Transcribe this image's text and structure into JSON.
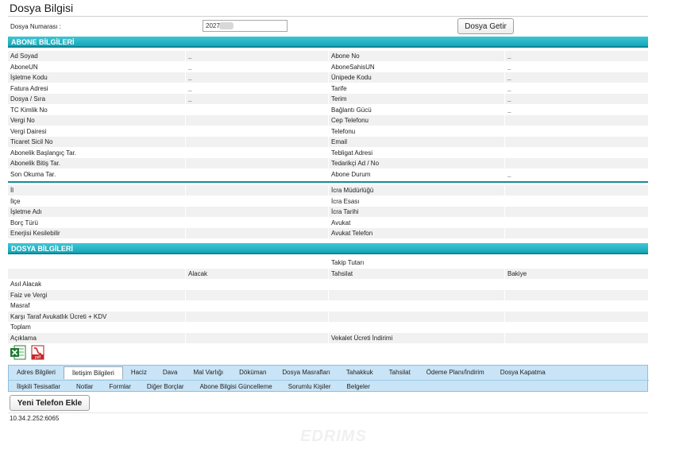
{
  "page": {
    "title": "Dosya Bilgisi"
  },
  "search": {
    "label": "Dosya Numarası :",
    "value": "2027",
    "button_label": "Dosya Getir"
  },
  "abone": {
    "section_title": "ABONE BİLGİLERİ",
    "rows": [
      {
        "label_left": "Ad Soyad",
        "value_left": "_",
        "label_right": "Abone No",
        "value_right": "_"
      },
      {
        "label_left": "AboneUN",
        "value_left": "_",
        "label_right": "AboneSahisUN",
        "value_right": "_"
      },
      {
        "label_left": "İşletme Kodu",
        "value_left": "_",
        "label_right": "Ünipede Kodu",
        "value_right": "_"
      },
      {
        "label_left": "Fatura Adresi",
        "value_left": "_",
        "label_right": "Tarife",
        "value_right": "_"
      },
      {
        "label_left": "Dosya / Sıra",
        "value_left": "_",
        "label_right": "Terim",
        "value_right": "_"
      },
      {
        "label_left": "TC Kimlik No",
        "value_left": "",
        "label_right": "Bağlantı Gücü",
        "value_right": "_"
      },
      {
        "label_left": "Vergi No",
        "value_left": "",
        "label_right": "Cep Telefonu",
        "value_right": ""
      },
      {
        "label_left": "Vergi Dairesi",
        "value_left": "",
        "label_right": "Telefonu",
        "value_right": ""
      },
      {
        "label_left": "Ticaret Sicil No",
        "value_left": "",
        "label_right": "Email",
        "value_right": ""
      },
      {
        "label_left": "Abonelik Başlangıç Tar.",
        "value_left": "",
        "label_right": "Tebligat Adresi",
        "value_right": ""
      },
      {
        "label_left": "Abonelik Bitiş Tar.",
        "value_left": "",
        "label_right": "Tedarikçi Ad / No",
        "value_right": ""
      },
      {
        "label_left": "Son Okuma Tar.",
        "value_left": "",
        "label_right": "Abone Durum",
        "value_right": "_"
      }
    ],
    "rows2": [
      {
        "label_left": "İl",
        "value_left": "",
        "label_right": "İcra Müdürlüğü",
        "value_right": ""
      },
      {
        "label_left": "İlçe",
        "value_left": "",
        "label_right": "İcra Esası",
        "value_right": ""
      },
      {
        "label_left": "İşletme Adı",
        "value_left": "",
        "label_right": "İcra Tarihi",
        "value_right": ""
      },
      {
        "label_left": "Borç Türü",
        "value_left": "",
        "label_right": "Avukat",
        "value_right": ""
      },
      {
        "label_left": "Enerjisi Kesilebilir",
        "value_left": "",
        "label_right": "Avukat Telefon",
        "value_right": ""
      }
    ]
  },
  "dosya": {
    "section_title": "DOSYA BİLGİLERİ",
    "takip_label": "Takip Tutarı",
    "col_alacak": "Alacak",
    "col_tahsilat": "Tahsilat",
    "col_bakiye": "Bakiye",
    "rows": [
      "Asıl Alacak",
      "Faiz ve Vergi",
      "Masraf",
      "Karşı Taraf Avukatlık Ücreti + KDV",
      "Toplam",
      "Açıklama"
    ],
    "vekalet_label": "Vekalet Ücreti İndirimi"
  },
  "file_icons": {
    "excel_icon": "excel-icon",
    "pdf_icon": "pdf-icon",
    "pdf_text": "pdf"
  },
  "tabs": {
    "row1": [
      "Adres Bilgileri",
      "İletişim Bilgileri",
      "Haciz",
      "Dava",
      "Mal Varlığı",
      "Döküman",
      "Dosya Masrafları",
      "Tahakkuk",
      "Tahsilat",
      "Ödeme Planı/İndirim",
      "Dosya Kapatma"
    ],
    "row2": [
      "İlişkili Tesisatlar",
      "Notlar",
      "Formlar",
      "Diğer Borçlar",
      "Abone Bilgisi Güncelleme",
      "Sorumlu Kişiler",
      "Belgeler"
    ],
    "active": "İletişim Bilgileri"
  },
  "actions": {
    "add_phone_label": "Yeni Telefon Ekle"
  },
  "footer": {
    "ip": "10.34.2.252:6065",
    "watermark": "EDRIMS"
  },
  "colors": {
    "section_bar": "#1fb0c0",
    "tab_bg": "#c8e4f6"
  }
}
